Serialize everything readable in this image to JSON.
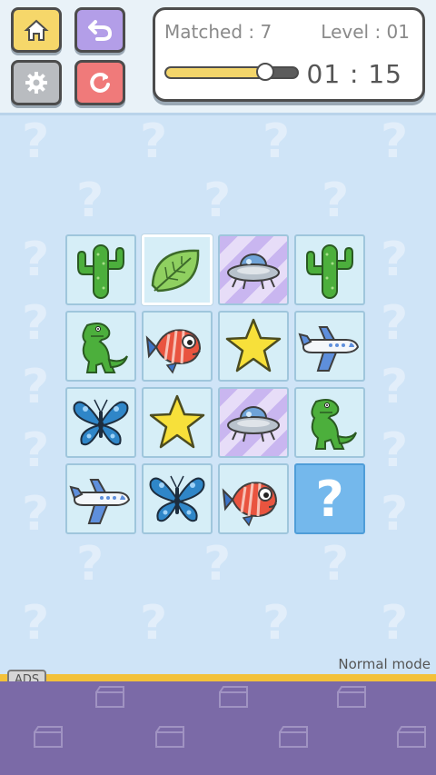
{
  "header": {
    "buttons": [
      {
        "name": "home-button",
        "icon": "home-icon"
      },
      {
        "name": "undo-button",
        "icon": "undo-icon"
      },
      {
        "name": "settings-button",
        "icon": "gear-icon"
      },
      {
        "name": "restart-button",
        "icon": "restart-icon"
      }
    ]
  },
  "status": {
    "matched": "Matched : 7",
    "level": "Level : 01",
    "timer": "01 : 15",
    "progress": 0.76
  },
  "board": {
    "tiles": [
      [
        "cactus",
        "leaf",
        "ufo",
        "cactus"
      ],
      [
        "dinosaur",
        "fish",
        "star",
        "airplane"
      ],
      [
        "butterfly",
        "star",
        "ufo",
        "dinosaur"
      ],
      [
        "airplane",
        "butterfly",
        "fish",
        "hidden"
      ]
    ],
    "hidden_symbol": "?"
  },
  "footer": {
    "mode": "Normal mode",
    "ads": "ADS"
  },
  "colors": {
    "background": "#cfe4f7",
    "hidden_tile": "#74b8ec",
    "adbar": "#7b6aa7",
    "accent_yellow": "#f3c13a"
  }
}
